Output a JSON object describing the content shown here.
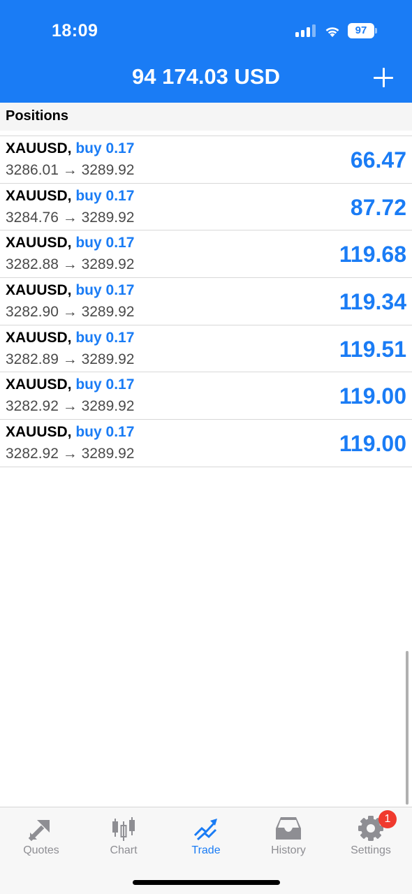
{
  "status_bar": {
    "time": "18:09",
    "battery": "97"
  },
  "header": {
    "balance": "94 174.03 USD"
  },
  "section": {
    "title": "Positions"
  },
  "positions": [
    {
      "symbol": "XAUUSD,",
      "side": "buy 0.17",
      "prices": "3286.01 → 3289.92",
      "profit": "66.47"
    },
    {
      "symbol": "XAUUSD,",
      "side": "buy 0.17",
      "prices": "3284.76 → 3289.92",
      "profit": "87.72"
    },
    {
      "symbol": "XAUUSD,",
      "side": "buy 0.17",
      "prices": "3282.88 → 3289.92",
      "profit": "119.68"
    },
    {
      "symbol": "XAUUSD,",
      "side": "buy 0.17",
      "prices": "3282.90 → 3289.92",
      "profit": "119.34"
    },
    {
      "symbol": "XAUUSD,",
      "side": "buy 0.17",
      "prices": "3282.89 → 3289.92",
      "profit": "119.51"
    },
    {
      "symbol": "XAUUSD,",
      "side": "buy 0.17",
      "prices": "3282.92 → 3289.92",
      "profit": "119.00"
    },
    {
      "symbol": "XAUUSD,",
      "side": "buy 0.17",
      "prices": "3282.92 → 3289.92",
      "profit": "119.00"
    }
  ],
  "tabs": [
    {
      "label": "Quotes",
      "icon": "quotes-arrows-icon"
    },
    {
      "label": "Chart",
      "icon": "candlestick-icon"
    },
    {
      "label": "Trade",
      "icon": "trade-trend-icon",
      "active": true
    },
    {
      "label": "History",
      "icon": "inbox-tray-icon"
    },
    {
      "label": "Settings",
      "icon": "gear-icon",
      "badge": "1"
    }
  ],
  "colors": {
    "accent": "#1a7cf5",
    "badge": "#f03a2e",
    "inactive_tab": "#8e8e93"
  }
}
